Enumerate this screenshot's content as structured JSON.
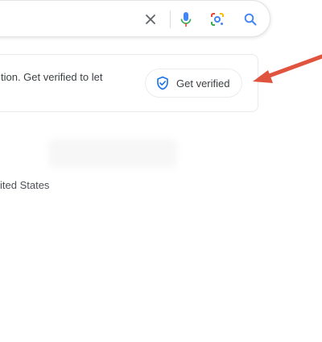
{
  "search": {
    "value": "",
    "placeholder": ""
  },
  "icons": {
    "clear": "close-icon",
    "voice": "microphone-icon",
    "lens": "google-lens-icon",
    "search": "search-icon",
    "verify": "shield-check-icon"
  },
  "verification_card": {
    "message": "tion. Get verified to let",
    "button_label": "Get verified"
  },
  "location": {
    "text": "ited States"
  },
  "colors": {
    "accent_blue": "#1a73e8",
    "mic_blue": "#4285f4",
    "arrow_red": "#e0533f"
  }
}
